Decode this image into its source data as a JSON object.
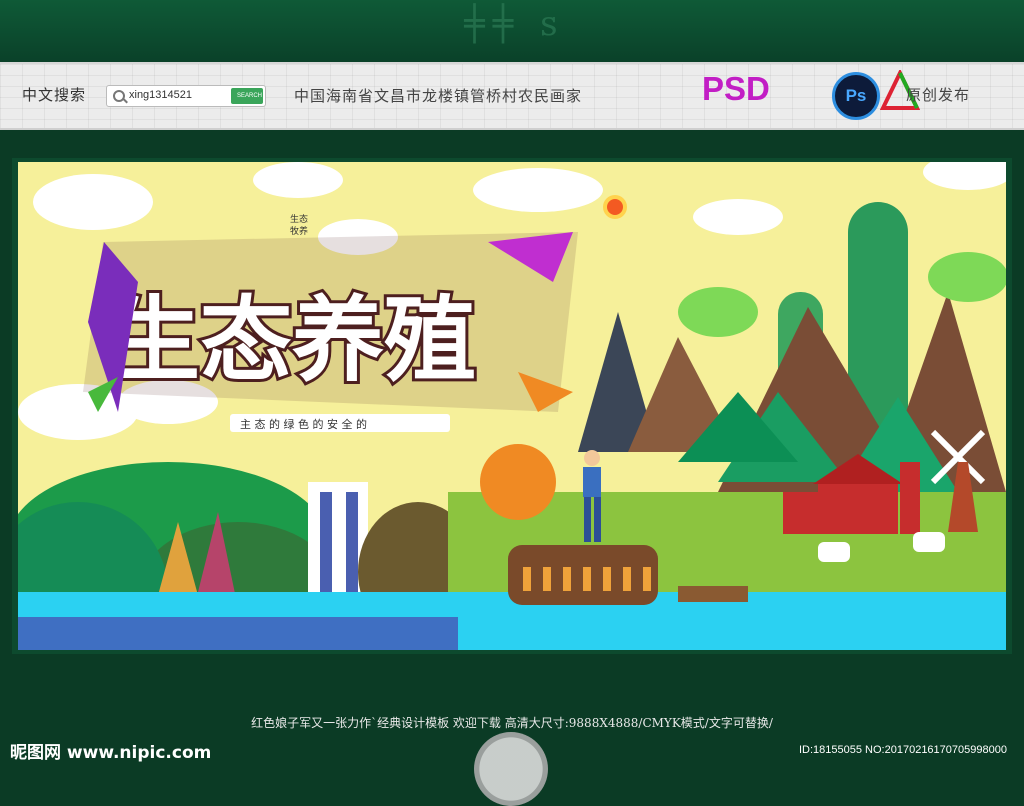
{
  "header": {
    "search_label": "中文搜索",
    "search_value": "xing1314521",
    "search_button": "SEARCH",
    "title": "中国海南省文昌市龙楼镇管桥村农民画家",
    "psd_label": "PSD",
    "ps_icon_label": "Ps",
    "original_label": "原创发布"
  },
  "banner": {
    "headline": "生态养殖",
    "subtitle": "主 态 的 绿 色 的 安 全 的",
    "tag_small": "生态\n牧养"
  },
  "footer": {
    "caption": "红色娘子军又一张力作`经典设计模板  欢迎下载 高清大尺寸:9888X4888/CMYK模式/文字可替换/",
    "site_logo": "昵图网 www.nipic.com",
    "site_id": "ID:18155055 NO:20170216170705998000"
  },
  "colors": {
    "brand_green": "#0b3b25",
    "psd_magenta": "#c21ec5",
    "sky": "#f6f09a",
    "water": "#2bd1f2"
  }
}
